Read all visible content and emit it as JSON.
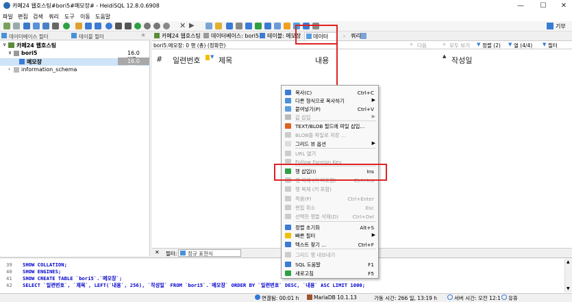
{
  "window": {
    "title": "카페24 웹호스팅#bori5#메모장# - HeidiSQL 12.8.0.6908"
  },
  "menubar": [
    "파일",
    "편집",
    "검색",
    "쿼리",
    "도구",
    "이동",
    "도움말"
  ],
  "donate": "기부",
  "left_tabs": {
    "db_filter": "데이터베이스 필터",
    "table_filter": "테이블 필터"
  },
  "tree": [
    {
      "label": "카페24 웹호스팅",
      "size": ""
    },
    {
      "label": "bori5",
      "size": "16.0 KiB"
    },
    {
      "label": "메모장",
      "size": "16.0 KiB"
    },
    {
      "label": "information_schema",
      "size": ""
    }
  ],
  "main_tabs": [
    "카페24 웹호스팅",
    "데이터베이스: bori5",
    "테이블: 메모장",
    "데이터",
    "쿼리*"
  ],
  "subbar": {
    "info": "bori5.메모장: 0 행 (총) (정확한)",
    "next": "다음",
    "show_all": "모두 보기",
    "sort": "정렬 (2)",
    "cols": "열 (4/4)",
    "filter": "필터"
  },
  "columns": [
    "#",
    "일련번호",
    "제목",
    "내용",
    "작성일"
  ],
  "filter_bar": {
    "label": "필터:",
    "regex": "정규 표현식"
  },
  "context_menu": [
    {
      "label": "복사(C)",
      "shortcut": "Ctrl+C",
      "color": "#3a7bd5",
      "disabled": false
    },
    {
      "label": "다른 형식으로 복사하기",
      "shortcut": "",
      "submenu": true,
      "color": "#4a90d9",
      "disabled": false
    },
    {
      "label": "붙여넣기(P)",
      "shortcut": "Ctrl+V",
      "color": "#5c9ee0",
      "disabled": false
    },
    {
      "label": "값 삽입",
      "shortcut": "",
      "submenu": true,
      "color": "#bbbbbb",
      "disabled": true
    },
    {
      "label": "TEXT/BLOB 필드에 파일 삽입...",
      "shortcut": "",
      "color": "#e06020",
      "disabled": false
    },
    {
      "label": "BLOB를 파일로 저장 ...",
      "shortcut": "",
      "color": "#cccccc",
      "disabled": true
    },
    {
      "label": "그리드 뷰 옵션",
      "shortcut": "",
      "submenu": true,
      "color": "#dddddd",
      "disabled": false
    },
    {
      "label": "URL 열기",
      "shortcut": "",
      "color": "#cccccc",
      "disabled": true
    },
    {
      "label": "Follow Foreign Key",
      "shortcut": "",
      "color": "#cccccc",
      "disabled": true
    },
    {
      "label": "행 삽입(I)",
      "shortcut": "Ins",
      "color": "#2ea043",
      "disabled": false
    },
    {
      "label": "행 복제 (키 미포함)",
      "shortcut": "Ctrl+Ins",
      "color": "#cccccc",
      "disabled": true
    },
    {
      "label": "행 복제 (키 포함)",
      "shortcut": "",
      "color": "#cccccc",
      "disabled": true
    },
    {
      "label": "적용(P)",
      "shortcut": "Ctrl+Enter",
      "color": "#cccccc",
      "disabled": true
    },
    {
      "label": "편집 취소",
      "shortcut": "Esc",
      "color": "#cccccc",
      "disabled": true
    },
    {
      "label": "선택한 행들 삭제(D)",
      "shortcut": "Ctrl+Del",
      "color": "#cccccc",
      "disabled": true
    },
    {
      "label": "정렬 초기화",
      "shortcut": "Alt+S",
      "color": "#3a7bd5",
      "disabled": false
    },
    {
      "label": "빠른 필터",
      "shortcut": "",
      "submenu": true,
      "color": "#f0c000",
      "disabled": false
    },
    {
      "label": "텍스트 찾기 ...",
      "shortcut": "Ctrl+F",
      "color": "#3a7bd5",
      "disabled": false
    },
    {
      "label": "그리드 행 내보내기",
      "shortcut": "",
      "color": "#cccccc",
      "disabled": true
    },
    {
      "label": "SQL 도움말",
      "shortcut": "F1",
      "color": "#3a7bd5",
      "disabled": false
    },
    {
      "label": "새로고침",
      "shortcut": "F5",
      "color": "#2ea043",
      "disabled": false
    }
  ],
  "sql_lines": [
    {
      "n": "39",
      "code": "SHOW COLLATION;"
    },
    {
      "n": "40",
      "code": "SHOW ENGINES;"
    },
    {
      "n": "41",
      "code": "SHOW CREATE TABLE `bori5`.`메모장`;"
    },
    {
      "n": "42",
      "code": "SELECT `일련번호`, `제목`, LEFT(`내용`, 256), `작성일` FROM `bori5`.`메모장` ORDER BY `일련번호` DESC, `내용` ASC LIMIT 1000;"
    }
  ],
  "status": {
    "connected": "연결됨: 00:01 h",
    "server": "MariaDB 10.1.13",
    "uptime": "가동 시간: 266 일, 13:19 h",
    "server_time": "서버 시간: 오전 12:1",
    "idle": "유휴"
  },
  "colors": {
    "highlight": "#e02020",
    "accent": "#3a7bd5"
  }
}
